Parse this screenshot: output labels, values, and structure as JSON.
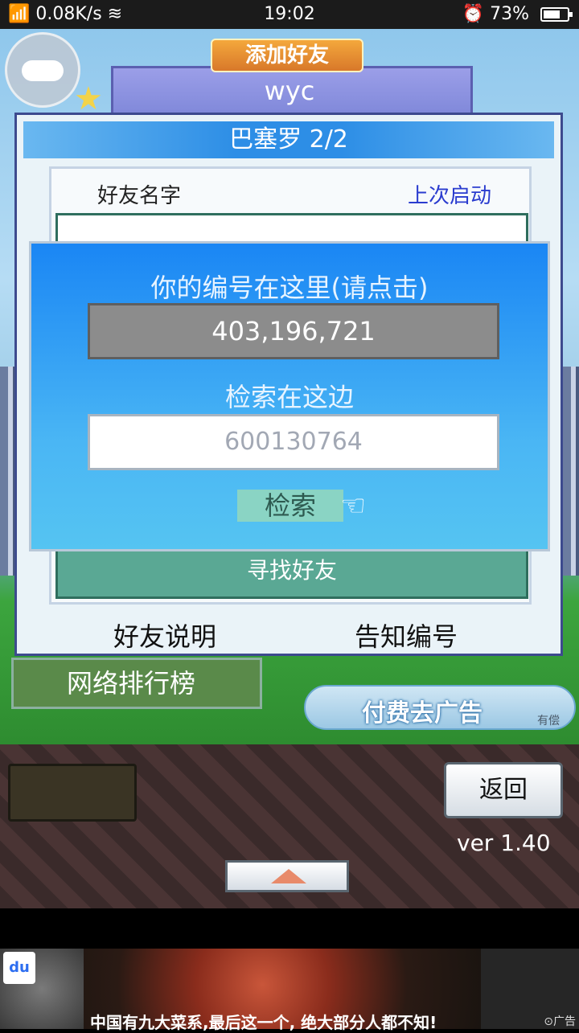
{
  "status_bar": {
    "network": "0.08K/s",
    "time": "19:02",
    "battery": "73%",
    "battery_level": 0.73
  },
  "header": {
    "banner_add": "添加好友",
    "user_name": "wyc"
  },
  "dialog": {
    "title": "巴塞罗 2/2",
    "col_name": "好友名字",
    "col_last_login": "上次启动",
    "find_friend": "寻找好友",
    "friend_help": "好友说明",
    "notify_id": "告知编号"
  },
  "overlay": {
    "title": "你的编号在这里(请点击)",
    "my_id": "403,196,721",
    "search_label": "检索在这边",
    "search_placeholder": "600130764",
    "search_button": "检索"
  },
  "under": {
    "ranking": "网络排行榜",
    "remove_ads": "付费去广告",
    "remove_ads_paid": "有偿"
  },
  "bottom": {
    "back": "返回",
    "version": "ver 1.40"
  },
  "ad": {
    "text": "中国有九大菜系,最后这一个, 绝大部分人都不知!",
    "tag": "广告",
    "logo": "du"
  }
}
